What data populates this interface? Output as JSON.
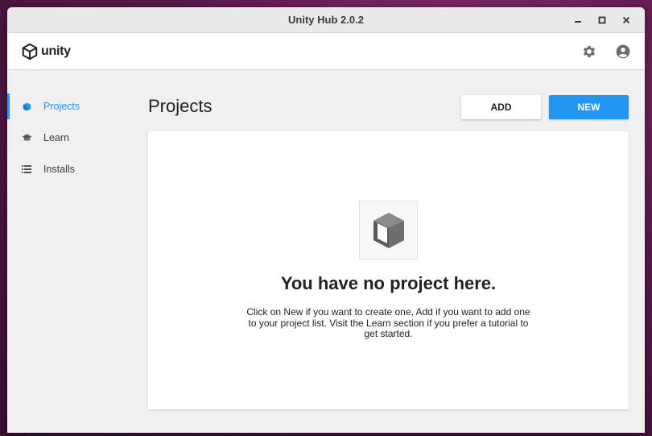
{
  "window": {
    "title": "Unity Hub 2.0.2"
  },
  "appbar": {
    "logo_text": "unity",
    "icons": [
      "gear-icon",
      "account-icon"
    ]
  },
  "sidebar": {
    "items": [
      {
        "label": "Projects",
        "icon": "cube-icon",
        "active": true
      },
      {
        "label": "Learn",
        "icon": "graduation-cap-icon",
        "active": false
      },
      {
        "label": "Installs",
        "icon": "list-icon",
        "active": false
      }
    ]
  },
  "main": {
    "title": "Projects",
    "add_label": "ADD",
    "new_label": "NEW",
    "empty_title": "You have no project here.",
    "empty_description": "Click on New if you want to create one, Add if you want to add one to your project list. Visit the Learn section if you prefer a tutorial to get started."
  },
  "colors": {
    "accent": "#2196f3",
    "background": "#f0f0f0"
  }
}
